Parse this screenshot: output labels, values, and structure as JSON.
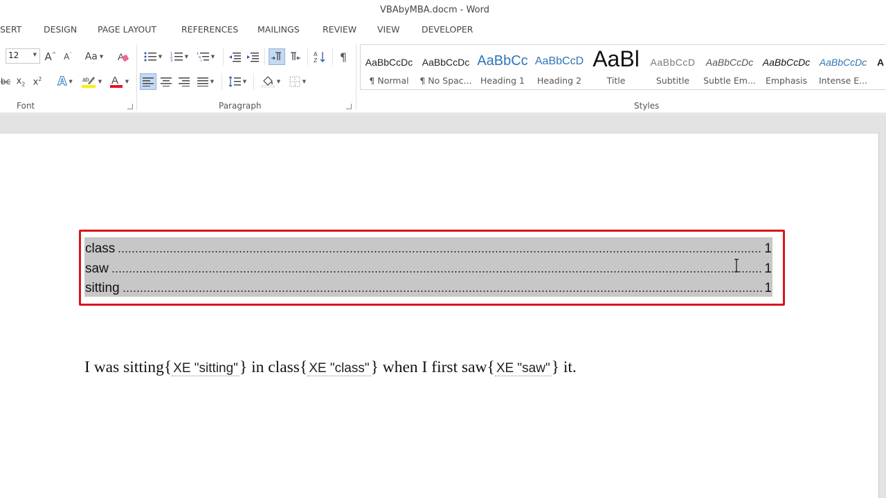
{
  "app": {
    "window_title": "VBAbyMBA.docm - Word"
  },
  "tabs": [
    "SERT",
    "DESIGN",
    "PAGE LAYOUT",
    "REFERENCES",
    "MAILINGS",
    "REVIEW",
    "VIEW",
    "DEVELOPER"
  ],
  "ribbon": {
    "font": {
      "size": "12",
      "change_case_label": "Aa",
      "group_label": "Font"
    },
    "paragraph": {
      "group_label": "Paragraph"
    },
    "styles": {
      "group_label": "Styles",
      "items": [
        {
          "sample": "AaBbCcDc",
          "name": "¶ Normal"
        },
        {
          "sample": "AaBbCcDc",
          "name": "¶ No Spac..."
        },
        {
          "sample": "AaBbCc",
          "name": "Heading 1"
        },
        {
          "sample": "AaBbCcD",
          "name": "Heading 2"
        },
        {
          "sample": "AaBl",
          "name": "Title"
        },
        {
          "sample": "AaBbCcD",
          "name": "Subtitle"
        },
        {
          "sample": "AaBbCcDc",
          "name": "Subtle Em..."
        },
        {
          "sample": "AaBbCcDc",
          "name": "Emphasis"
        },
        {
          "sample": "AaBbCcDc",
          "name": "Intense E..."
        },
        {
          "sample": "A",
          "name": ""
        }
      ]
    }
  },
  "document": {
    "index_entries": [
      {
        "term": "class",
        "page": "1"
      },
      {
        "term": "saw",
        "page": "1"
      },
      {
        "term": "sitting",
        "page": "1"
      }
    ],
    "paragraph": {
      "t1": "I was sitting",
      "f1": "XE \"sitting\"",
      "t2": " in class",
      "f2": "XE \"class\"",
      "t3": " when I first saw",
      "f3": "XE \"saw\"",
      "t4": " it."
    }
  },
  "colors": {
    "highlight_border": "#d9151c",
    "index_shading": "#c7c7c7",
    "accent_blue": "#2b579a"
  }
}
